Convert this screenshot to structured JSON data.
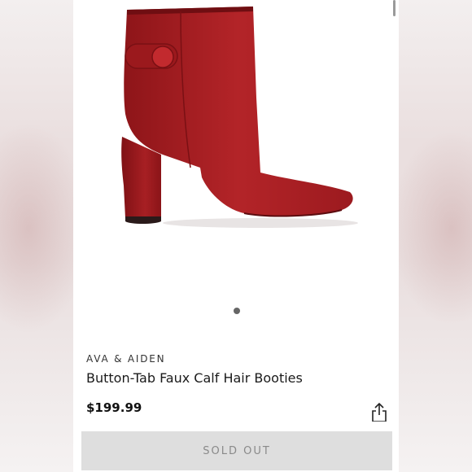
{
  "product": {
    "brand": "AVA & AIDEN",
    "title": "Button-Tab Faux Calf Hair Booties",
    "price": "$199.99",
    "image_icon": "red-ankle-boot-image",
    "color": "#a51f24"
  },
  "carousel": {
    "current": 1,
    "total": 1
  },
  "actions": {
    "share_icon": "share-icon",
    "sold_out_label": "SOLD OUT"
  }
}
